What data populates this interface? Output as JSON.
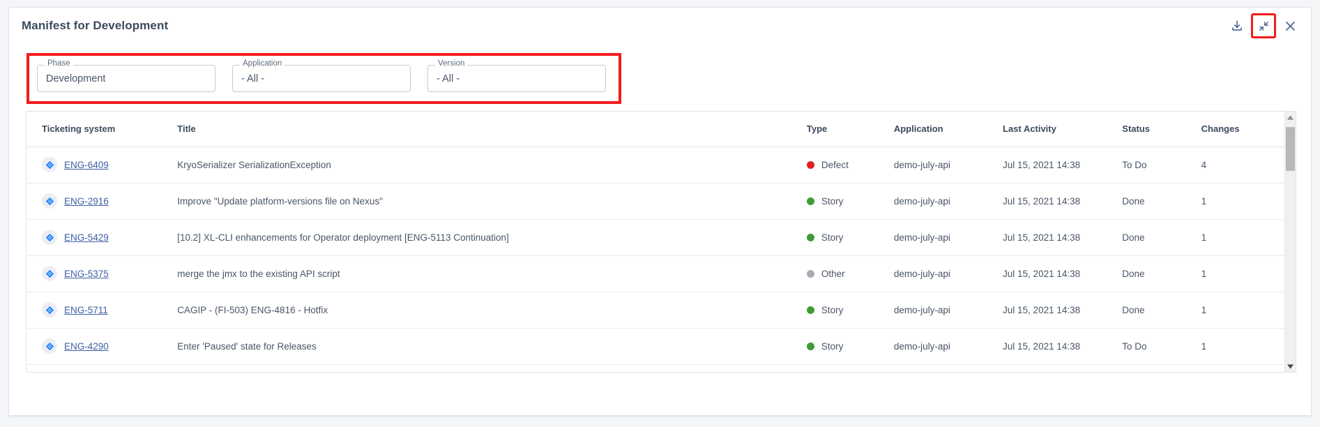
{
  "header": {
    "title": "Manifest for Development",
    "actions": [
      {
        "name": "download-icon",
        "label": "Download"
      },
      {
        "name": "collapse-icon",
        "label": "Collapse",
        "highlighted": true
      },
      {
        "name": "close-icon",
        "label": "Close"
      }
    ]
  },
  "filters": [
    {
      "label": "Phase",
      "value": "Development"
    },
    {
      "label": "Application",
      "value": "- All -"
    },
    {
      "label": "Version",
      "value": "- All -"
    }
  ],
  "table": {
    "columns": [
      "Ticketing system",
      "Title",
      "Type",
      "Application",
      "Last Activity",
      "Status",
      "Changes"
    ],
    "rows": [
      {
        "ticket": "ENG-6409",
        "title": "KryoSerializer SerializationException",
        "type": "Defect",
        "type_color": "#e02020",
        "application": "demo-july-api",
        "last_activity": "Jul 15, 2021 14:38",
        "status": "To Do",
        "changes": "4"
      },
      {
        "ticket": "ENG-2916",
        "title": "Improve \"Update platform-versions file on Nexus\"",
        "type": "Story",
        "type_color": "#3f9c35",
        "application": "demo-july-api",
        "last_activity": "Jul 15, 2021 14:38",
        "status": "Done",
        "changes": "1"
      },
      {
        "ticket": "ENG-5429",
        "title": "[10.2] XL-CLI enhancements for Operator deployment [ENG-5113 Continuation]",
        "type": "Story",
        "type_color": "#3f9c35",
        "application": "demo-july-api",
        "last_activity": "Jul 15, 2021 14:38",
        "status": "Done",
        "changes": "1"
      },
      {
        "ticket": "ENG-5375",
        "title": "merge the jmx to the existing API script",
        "type": "Other",
        "type_color": "#a8adb5",
        "application": "demo-july-api",
        "last_activity": "Jul 15, 2021 14:38",
        "status": "Done",
        "changes": "1"
      },
      {
        "ticket": "ENG-5711",
        "title": "CAGIP - (FI-503) ENG-4816 - Hotfix",
        "type": "Story",
        "type_color": "#3f9c35",
        "application": "demo-july-api",
        "last_activity": "Jul 15, 2021 14:38",
        "status": "Done",
        "changes": "1"
      },
      {
        "ticket": "ENG-4290",
        "title": "Enter 'Paused' state for Releases",
        "type": "Story",
        "type_color": "#3f9c35",
        "application": "demo-july-api",
        "last_activity": "Jul 15, 2021 14:38",
        "status": "To Do",
        "changes": "1"
      }
    ]
  },
  "colors": {
    "highlight": "#f51b1b",
    "link": "#3c5fa5",
    "title": "#3c4a5e",
    "page_bg": "#f4f6f9"
  }
}
